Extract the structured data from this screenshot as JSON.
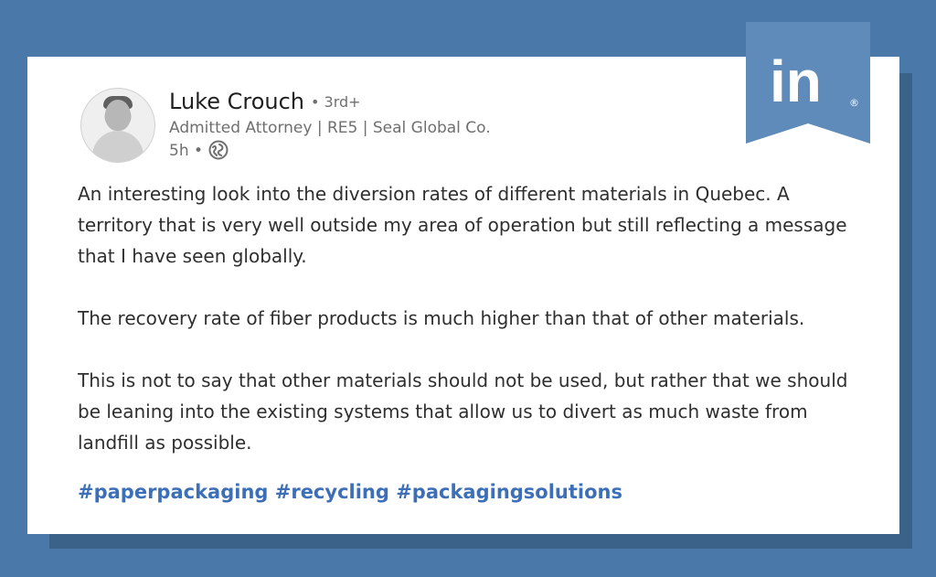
{
  "colors": {
    "background": "#4a79a9",
    "card": "#ffffff",
    "shadow": "#3b6288",
    "name": "#1f1f1f",
    "meta": "#6f6f6f",
    "body_text": "#2f2f2f",
    "hashtags": "#3c6fb8",
    "linkedin_badge": "#5f8bbb"
  },
  "brand": {
    "icon": "linkedin-icon",
    "text": "in",
    "registered": "®"
  },
  "author": {
    "name": "Luke Crouch",
    "degree": "• 3rd+",
    "title": "Admitted Attorney | RE5 | Seal Global Co.",
    "time": "5h •",
    "visibility_icon": "globe-icon",
    "avatar_icon": "profile-avatar"
  },
  "post": {
    "paragraphs": [
      "An interesting look into the diversion rates of different materials in Quebec. A territory that is very well outside my area of operation but still reflecting a message that I have seen globally.",
      "The recovery rate of fiber products is much higher than that of other materials.",
      "This is not to say that other materials should not be used, but rather that we should be leaning into the existing systems that allow us to divert as much waste from landfill as possible."
    ],
    "hashtags": "#paperpackaging #recycling #packagingsolutions"
  }
}
